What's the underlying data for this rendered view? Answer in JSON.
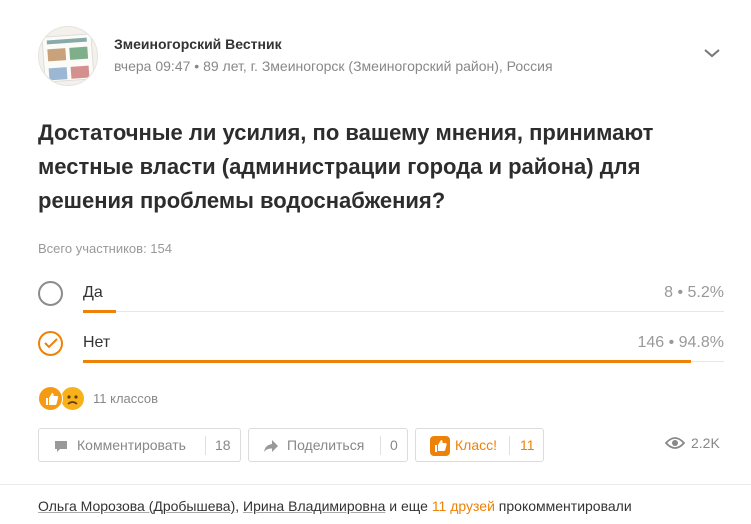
{
  "post": {
    "author": "Змеиногорский Вестник",
    "meta": "вчера 09:47 • 89 лет, г. Змеиногорск (Змеиногорский район), Россия",
    "menu_icon": "chevron-down-icon"
  },
  "poll": {
    "question": "Достаточные ли усилия, по вашему мнения, принимают местные власти (администрации города и района) для решения проблемы водоснабжения?",
    "total_label": "Всего участников: 154",
    "options": [
      {
        "label": "Да",
        "stat": "8 • 5.2%",
        "fraction": 0.052,
        "selected": false
      },
      {
        "label": "Нет",
        "stat": "146 • 94.8%",
        "fraction": 0.948,
        "selected": true
      }
    ]
  },
  "reactions": {
    "count_label": "11 классов",
    "icons": [
      "like-reaction-icon",
      "sad-reaction-icon"
    ]
  },
  "actions": {
    "comment": {
      "label": "Комментировать",
      "count": "18"
    },
    "share": {
      "label": "Поделиться",
      "count": "0"
    },
    "klass": {
      "label": "Класс!",
      "count": "11"
    },
    "views": "2.2K"
  },
  "footer": {
    "name1": "Ольга Морозова (Дробышева)",
    "comma": ", ",
    "name2": "Ирина Владимировна",
    "and_more": " и еще ",
    "friends": "11 друзей",
    "suffix": " прокомментировали"
  },
  "colors": {
    "accent": "#ee8208",
    "muted": "#888888"
  }
}
